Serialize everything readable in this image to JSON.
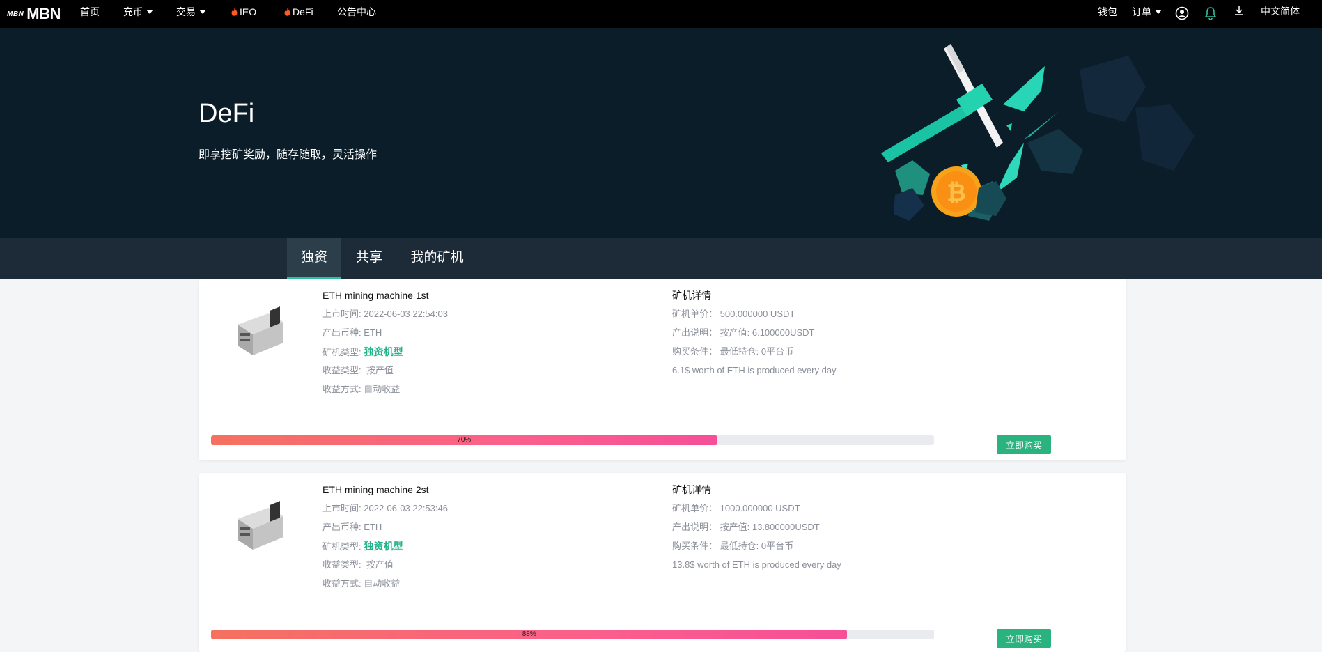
{
  "nav": {
    "logo_small": "MBN",
    "logo_big": "MBN",
    "items": [
      {
        "label": "首页"
      },
      {
        "label": "充币"
      },
      {
        "label": "交易"
      },
      {
        "label": "IEO"
      },
      {
        "label": "DeFi"
      },
      {
        "label": "公告中心"
      }
    ],
    "right": {
      "wallet": "钱包",
      "orders": "订单",
      "language": "中文简体"
    }
  },
  "hero": {
    "title": "DeFi",
    "subtitle": "即享挖矿奖励，随存随取，灵活操作"
  },
  "tabs": [
    {
      "label": "独资"
    },
    {
      "label": "共享"
    },
    {
      "label": "我的矿机"
    }
  ],
  "colors": {
    "accent_green": "#2fc0a0",
    "buy_button": "#2ab37f",
    "highlight_text": "#21b38a",
    "progress_start": "#f5715f",
    "progress_end": "#f64f97"
  },
  "machines": [
    {
      "name": "ETH mining machine 1st",
      "launch_label": "上市时间:",
      "launch_value": "2022-06-03 22:54:03",
      "coin_label": "产出币种:",
      "coin_value": "ETH",
      "type_label": "矿机类型:",
      "type_value": "独资机型",
      "income_type_label": "收益类型:",
      "income_type_value": "按产值",
      "income_mode_label": "收益方式:",
      "income_mode_value": "自动收益",
      "detail_title": "矿机详情",
      "price_label": "矿机单价：",
      "price_value": "500.000000 USDT",
      "output_label": "产出说明：",
      "output_value": "按产值: 6.100000USDT",
      "condition_label": "购买条件：",
      "condition_value": "最低持仓: 0平台币",
      "daily_note": "6.1$ worth of ETH is produced every day",
      "progress_percent": 70,
      "progress_label": "70%",
      "buy_label": "立即购买"
    },
    {
      "name": "ETH mining machine 2st",
      "launch_label": "上市时间:",
      "launch_value": "2022-06-03 22:53:46",
      "coin_label": "产出币种:",
      "coin_value": "ETH",
      "type_label": "矿机类型:",
      "type_value": "独资机型",
      "income_type_label": "收益类型:",
      "income_type_value": "按产值",
      "income_mode_label": "收益方式:",
      "income_mode_value": "自动收益",
      "detail_title": "矿机详情",
      "price_label": "矿机单价：",
      "price_value": "1000.000000 USDT",
      "output_label": "产出说明：",
      "output_value": "按产值: 13.800000USDT",
      "condition_label": "购买条件：",
      "condition_value": "最低持仓: 0平台币",
      "daily_note": "13.8$ worth of ETH is produced every day",
      "progress_percent": 88,
      "progress_label": "88%",
      "buy_label": "立即购买"
    }
  ]
}
